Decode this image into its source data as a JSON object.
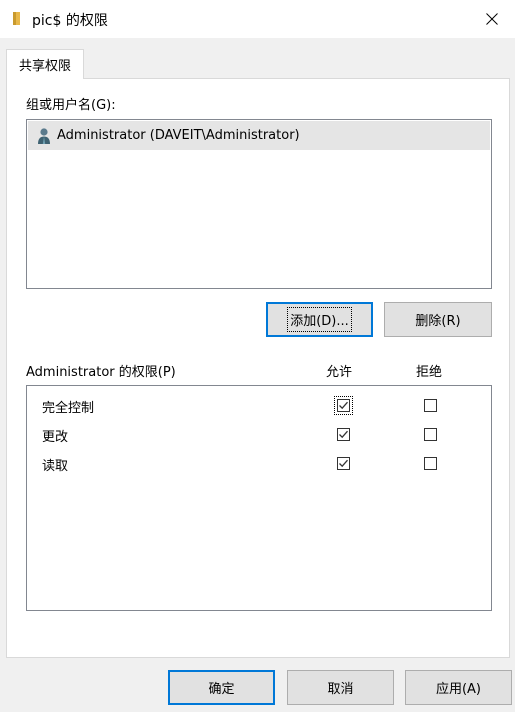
{
  "window": {
    "title": "pic$ 的权限",
    "folder_icon_color": "#e8b84a"
  },
  "tab": {
    "label": "共享权限"
  },
  "group_section": {
    "label": "组或用户名(G):",
    "users": [
      {
        "name": "Administrator (DAVEIT\\Administrator)",
        "icon": "user-icon",
        "selected": true
      }
    ]
  },
  "buttons": {
    "add": "添加(D)...",
    "remove": "删除(R)",
    "ok": "确定",
    "cancel": "取消",
    "apply": "应用(A)"
  },
  "permissions": {
    "header": "Administrator 的权限(P)",
    "allow_label": "允许",
    "deny_label": "拒绝",
    "rows": [
      {
        "name": "完全控制",
        "allow": true,
        "deny": false
      },
      {
        "name": "更改",
        "allow": true,
        "deny": false
      },
      {
        "name": "读取",
        "allow": true,
        "deny": false
      }
    ]
  },
  "colors": {
    "accent": "#0078d7",
    "selection": "#e5e5e5"
  }
}
